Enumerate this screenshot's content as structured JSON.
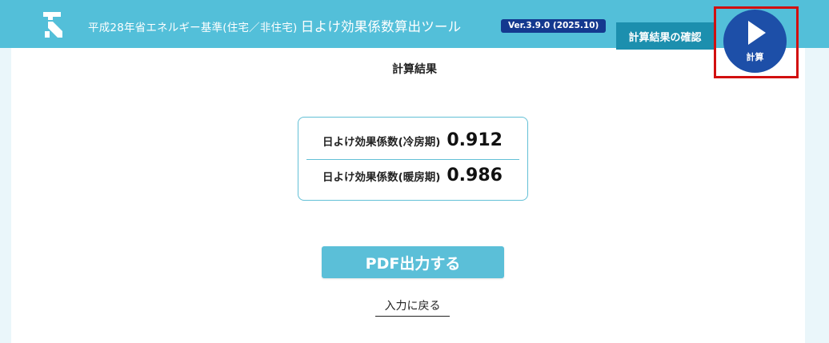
{
  "header": {
    "title_small": "平成28年省エネルギー基準(住宅／非住宅)",
    "title_large": "日よけ効果係数算出ツール",
    "version": "Ver.3.9.0 (2025.10)",
    "confirm_label": "計算結果の確認",
    "calc_label": "計算",
    "logo_icon": "building-logo-icon",
    "calc_icon": "play-icon"
  },
  "main": {
    "section_title": "計算結果",
    "results": [
      {
        "label": "日よけ効果係数(冷房期)",
        "value": "0.912"
      },
      {
        "label": "日よけ効果係数(暖房期)",
        "value": "0.986"
      }
    ],
    "pdf_label": "PDF出力する",
    "back_label": "入力に戻る"
  },
  "colors": {
    "header_bg": "#53bfd9",
    "version_bg": "#14398f",
    "confirm_bg": "#1c8fae",
    "calc_bg": "#1d4fa8",
    "highlight_frame": "#d20f0f",
    "side_bg": "#eaf6fa",
    "box_border": "#63c0d6",
    "pdf_bg": "#5bbfd8"
  }
}
